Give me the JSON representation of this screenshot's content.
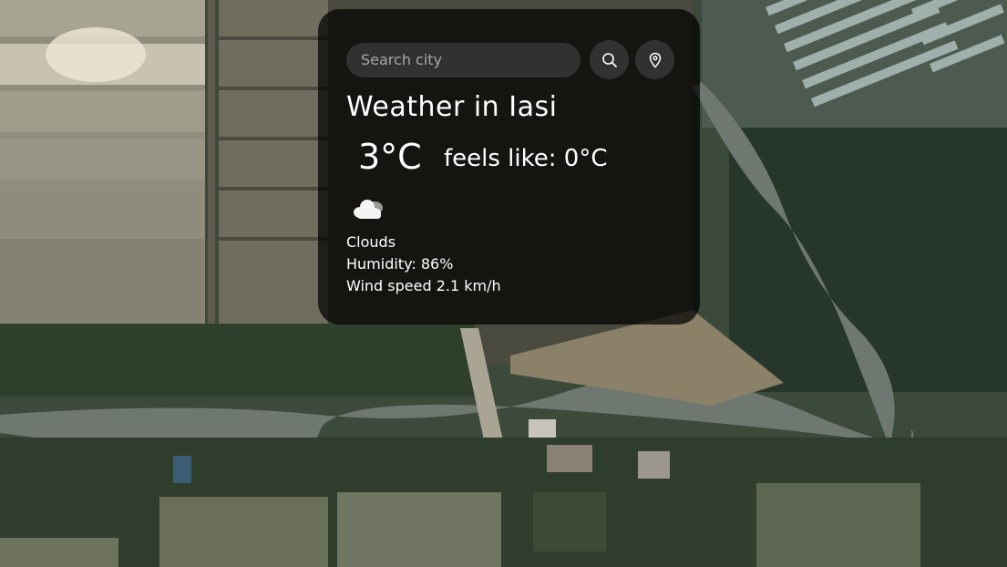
{
  "search": {
    "placeholder": "Search city"
  },
  "icons": {
    "search_button": "search-icon",
    "location_button": "location-pin-icon",
    "weather": "cloud-icon"
  },
  "weather": {
    "title": "Weather in Iasi",
    "temperature": "3°C",
    "feels_like": "feels like: 0°C",
    "description": "Clouds",
    "humidity": "Humidity: 86%",
    "wind": "Wind speed 2.1 km/h"
  },
  "colors": {
    "card_background": "#000000",
    "text": "#ffffff",
    "control_background": "#7c7c7c"
  }
}
